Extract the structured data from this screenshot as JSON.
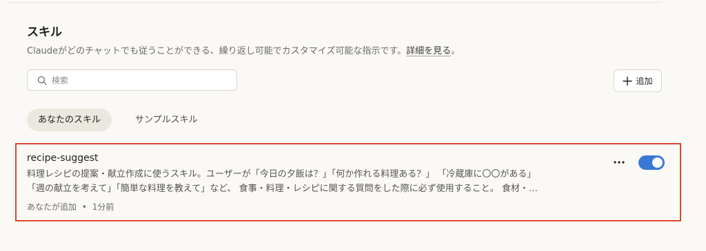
{
  "skills_section": {
    "title": "スキル",
    "description": "Claudeがどのチャットでも従うことができる、繰り返し可能でカスタマイズ可能な指示です。",
    "learn_more": "詳細を見る",
    "description_end": "。"
  },
  "search": {
    "placeholder": "検索",
    "value": ""
  },
  "add_button": {
    "label": "追加",
    "icon": "plus-icon"
  },
  "tabs": [
    {
      "label": "あなたのスキル",
      "selected": true
    },
    {
      "label": "サンプルスキル",
      "selected": false
    }
  ],
  "skill": {
    "name": "recipe-suggest",
    "description_line1": "料理レシピの提案・献立作成に使うスキル。ユーザーが「今日の夕飯は？」「何か作れる料理ある？」 「冷蔵庫に〇〇がある」",
    "description_line2": "「週の献立を考えて」「簡単な料理を教えて」など、 食事・料理・レシピに関する質問をした際に必ず使用すること。 食材・…",
    "added_by": "あなたが追加",
    "separator": "•",
    "time": "1分前",
    "enabled": true
  },
  "colors": {
    "background": "#faf9f5",
    "toggle_on": "#3a78d6",
    "highlight_border": "#e0452f"
  }
}
